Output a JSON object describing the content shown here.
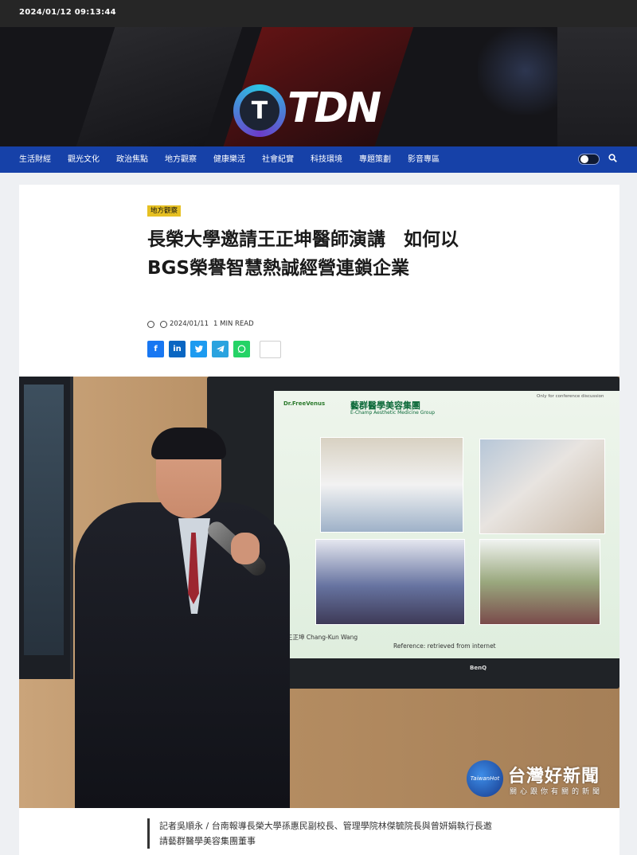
{
  "topbar": {
    "datetime": "2024/01/12 09:13:44"
  },
  "brand": {
    "logo_mark": "T",
    "logo_text": "TDN"
  },
  "nav": {
    "items": [
      "生活財經",
      "觀光文化",
      "政治焦點",
      "地方觀察",
      "健康樂活",
      "社會紀實",
      "科技環境",
      "專題策劃",
      "影音專區"
    ],
    "search_icon": "search-icon",
    "theme_toggle_icon": "theme-toggle-icon"
  },
  "article": {
    "category": "地方觀察",
    "title": "長榮大學邀請王正坤醫師演講　如何以BGS榮譽智慧熱誠經營連鎖企業",
    "date": "2024/01/11",
    "read_time": "1 MIN READ",
    "share_icons": [
      "facebook-icon",
      "linkedin-icon",
      "twitter-icon",
      "telegram-icon",
      "whatsapp-icon",
      "more-share"
    ],
    "photo": {
      "slide_logo": "Dr.FreeVenus",
      "slide_title": "藝群醫學美容集團",
      "slide_subtitle": "E-Champ Aesthetic Medicine Group",
      "slide_note": "Only for conference discussion",
      "slide_caption": "王正坤 Chang-Kun Wang",
      "slide_reference": "Reference: retrieved from internet",
      "tv_brand": "BenQ",
      "watermark_logo": "TaiwanHot",
      "watermark_title": "台灣好新聞",
      "watermark_slogan": "關心跟你有關的新聞"
    },
    "caption": "記者吳順永 / 台南報導長榮大學孫惠民副校長、管理學院林傑毓院長與曾妍娟執行長邀請藝群醫學美容集團董事"
  },
  "colors": {
    "topbar_bg": "#262626",
    "nav_bg": "#1641a8",
    "category_badge": "#e6c022",
    "facebook": "#1877f2",
    "linkedin": "#0a66c2",
    "twitter": "#1d9bf0",
    "telegram": "#2aa3df",
    "whatsapp": "#25d366"
  }
}
